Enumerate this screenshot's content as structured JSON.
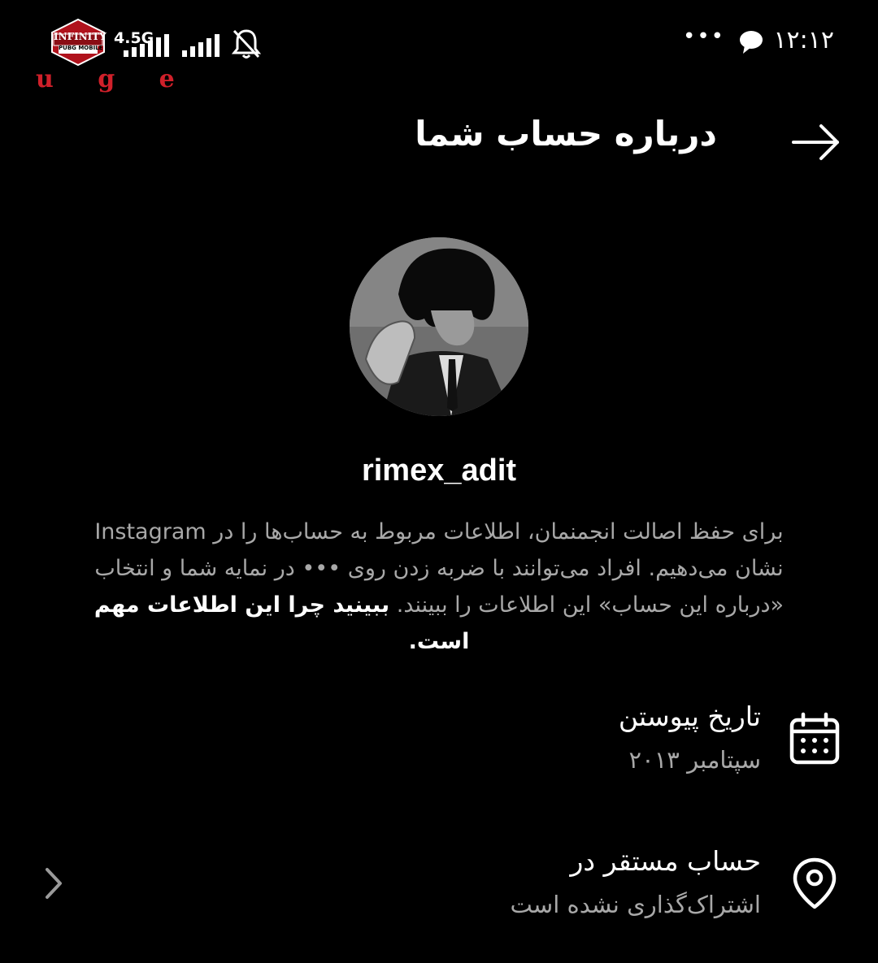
{
  "status_bar": {
    "time": "۱۲:۱۲",
    "network": "4.5G",
    "logo_text": "INFINITY",
    "logo_subtext": "PUBG MOBILE",
    "overlay_letters": "u g e",
    "icons": [
      "message-icon",
      "signal-icon",
      "signal-icon",
      "bell-muted-icon",
      "more-dots-icon"
    ]
  },
  "header": {
    "title": "درباره حساب شما",
    "back_icon": "arrow-right-icon"
  },
  "profile": {
    "username": "rimex_adit",
    "description_line1": "برای حفظ اصالت انجمنمان، اطلاعات مربوط به حساب‌ها را در Instagram",
    "description_line2": "نشان می‌دهیم. افراد می‌توانند با ضربه زدن روی ••• در نمایه شما و انتخاب",
    "description_line3_plain": "«درباره این حساب» این اطلاعات را ببینند. ",
    "description_link": "ببینید چرا این اطلاعات مهم است."
  },
  "rows": [
    {
      "icon": "calendar-icon",
      "title": "تاریخ پیوستن",
      "subtitle": "سپتامبر ۲۰۱۳"
    },
    {
      "icon": "location-pin-icon",
      "title": "حساب مستقر در",
      "subtitle": "اشتراک‌گذاری نشده است",
      "chevron_icon": "chevron-left-icon"
    }
  ]
}
